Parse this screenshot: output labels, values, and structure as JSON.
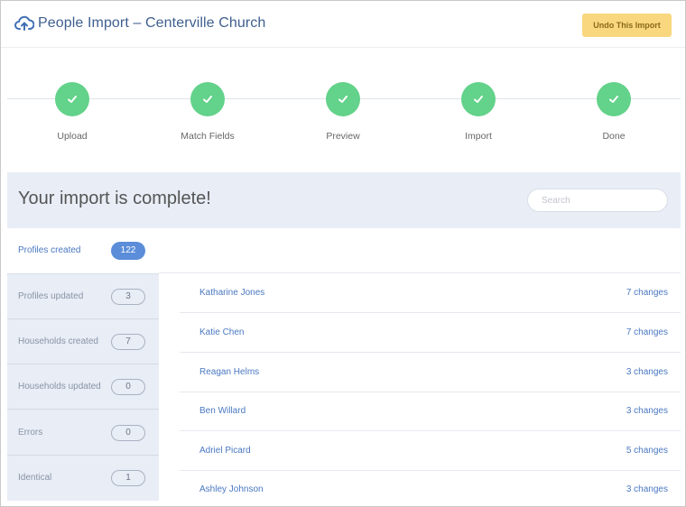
{
  "header": {
    "title": "People Import – Centerville Church",
    "undo_label": "Undo This Import",
    "icon": "cloud-upload-icon",
    "accent_color": "#3f5f8f",
    "undo_color": "#f9d77e"
  },
  "steps": [
    {
      "label": "Upload",
      "status": "complete"
    },
    {
      "label": "Match Fields",
      "status": "complete"
    },
    {
      "label": "Preview",
      "status": "complete"
    },
    {
      "label": "Import",
      "status": "complete"
    },
    {
      "label": "Done",
      "status": "complete"
    }
  ],
  "step_color": "#63d28a",
  "banner": {
    "heading": "Your import is complete!",
    "search_placeholder": "Search"
  },
  "tabs": [
    {
      "label": "Profiles created",
      "count": "122",
      "active": true
    },
    {
      "label": "Profiles updated",
      "count": "3",
      "active": false
    },
    {
      "label": "Households created",
      "count": "7",
      "active": false
    },
    {
      "label": "Households updated",
      "count": "0",
      "active": false
    },
    {
      "label": "Errors",
      "count": "0",
      "active": false
    },
    {
      "label": "Identical",
      "count": "1",
      "active": false
    }
  ],
  "people": [
    {
      "name": "Katharine Jones",
      "changes": "7 changes"
    },
    {
      "name": "Katie Chen",
      "changes": "7 changes"
    },
    {
      "name": "Reagan Helms",
      "changes": "3 changes"
    },
    {
      "name": "Ben Willard",
      "changes": "3 changes"
    },
    {
      "name": "Adriel Picard",
      "changes": "5 changes"
    },
    {
      "name": "Ashley Johnson",
      "changes": "3 changes"
    }
  ]
}
